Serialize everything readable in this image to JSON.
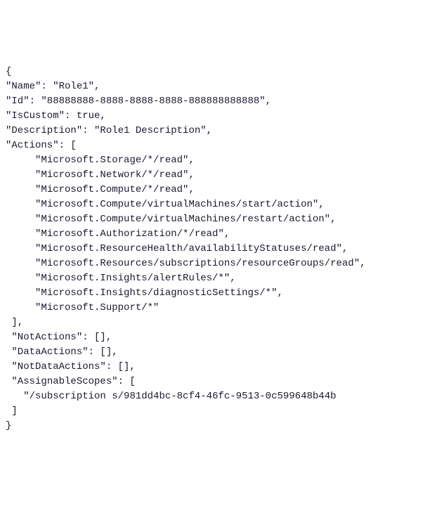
{
  "role": {
    "open_brace": "{",
    "name_line": "\"Name\": \"Role1\",",
    "id_line": "\"Id\": \"88888888-8888-8888-8888-888888888888\",",
    "iscustom_line": "\"IsCustom\": true,",
    "description_line": "\"Description\": \"Role1 Description\",",
    "actions_open": "\"Actions\": [",
    "actions": [
      "\"Microsoft.Storage/*/read\",",
      "\"Microsoft.Network/*/read\",",
      "\"Microsoft.Compute/*/read\",",
      "\"Microsoft.Compute/virtualMachines/start/action\",",
      "\"Microsoft.Compute/virtualMachines/restart/action\",",
      "\"Microsoft.Authorization/*/read\",",
      "\"Microsoft.ResourceHealth/availabilityStatuses/read\",",
      "\"Microsoft.Resources/subscriptions/resourceGroups/read\",",
      "\"Microsoft.Insights/alertRules/*\",",
      "\"Microsoft.Insights/diagnosticSettings/*\",",
      "\"Microsoft.Support/*\""
    ],
    "actions_close": "],",
    "notactions_line": "\"NotActions\": [],",
    "dataactions_line": "\"DataActions\": [],",
    "notdataactions_line": "\"NotDataActions\": [],",
    "assignablescopes_open": "\"AssignableScopes\": [",
    "assignablescopes_value": "\"/subscription s/981dd4bc-8cf4-46fc-9513-0c599648b44b",
    "assignablescopes_close": "]",
    "close_brace": "}"
  }
}
